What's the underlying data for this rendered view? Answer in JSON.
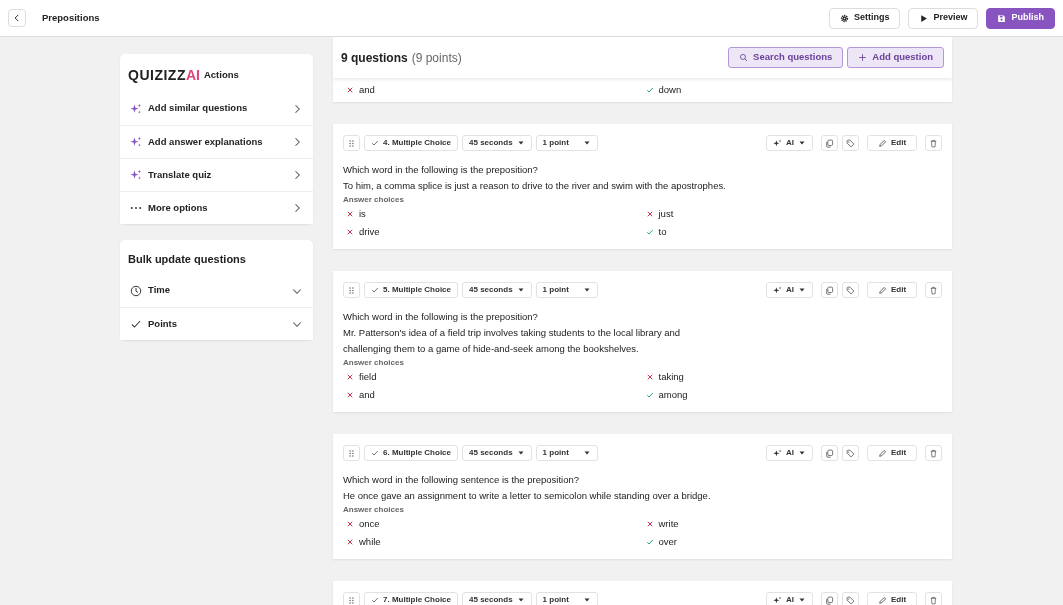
{
  "topbar": {
    "title": "Prepositions",
    "buttons": [
      {
        "label": "Settings",
        "kind": "settings"
      },
      {
        "label": "Preview",
        "kind": "preview"
      },
      {
        "label": "Publish",
        "kind": "publish"
      }
    ]
  },
  "ai_panel": {
    "logo": "QUIZIZZ",
    "logo_ai": "AI",
    "title": "Actions",
    "items": [
      {
        "label": "Add similar questions",
        "kind": "ai"
      },
      {
        "label": "Add answer explanations",
        "kind": "ai"
      },
      {
        "label": "Translate quiz",
        "kind": "ai"
      },
      {
        "label": "More options",
        "kind": "more"
      }
    ]
  },
  "bulk_panel": {
    "title": "Bulk update questions",
    "items": [
      {
        "label": "Time",
        "kind": "time"
      },
      {
        "label": "Points",
        "kind": "points"
      }
    ]
  },
  "questions_header": {
    "count": "9 questions",
    "points": "(9 points)",
    "buttons": [
      {
        "label": "Search questions",
        "kind": "search"
      },
      {
        "label": "Add question",
        "kind": "add"
      }
    ]
  },
  "questions": [
    {
      "answers": [
        {
          "text": "and",
          "correct": false
        },
        {
          "text": "down",
          "correct": true
        }
      ]
    },
    {
      "toolbar": {
        "type": "4. Multiple Choice",
        "time": "45 seconds",
        "points": "1 point",
        "ai": "AI",
        "edit": "Edit"
      },
      "lines": [
        "Which word in the following is the preposition?",
        "To him, a comma splice is just a reason to drive to the river and swim with the apostrophes."
      ],
      "answers_label": "Answer choices",
      "answers": [
        {
          "text": "is",
          "correct": false
        },
        {
          "text": "just",
          "correct": false
        },
        {
          "text": "drive",
          "correct": false
        },
        {
          "text": "to",
          "correct": true
        }
      ]
    },
    {
      "toolbar": {
        "type": "5. Multiple Choice",
        "time": "45 seconds",
        "points": "1 point",
        "ai": "AI",
        "edit": "Edit"
      },
      "lines": [
        "Which word in the following is the preposition?",
        "Mr. Patterson's idea of a field trip involves taking students to the local library and",
        "challenging them to a game of hide-and-seek among the bookshelves."
      ],
      "answers_label": "Answer choices",
      "answers": [
        {
          "text": "field",
          "correct": false
        },
        {
          "text": "taking",
          "correct": false
        },
        {
          "text": "and",
          "correct": false
        },
        {
          "text": "among",
          "correct": true
        }
      ]
    },
    {
      "toolbar": {
        "type": "6. Multiple Choice",
        "time": "45 seconds",
        "points": "1 point",
        "ai": "AI",
        "edit": "Edit"
      },
      "lines": [
        "Which word in the following sentence is the preposition?",
        "He once gave an assignment to write a letter to semicolon while standing over a bridge."
      ],
      "answers_label": "Answer choices",
      "answers": [
        {
          "text": "once",
          "correct": false
        },
        {
          "text": "write",
          "correct": false
        },
        {
          "text": "while",
          "correct": false
        },
        {
          "text": "over",
          "correct": true
        }
      ]
    },
    {
      "toolbar": {
        "type": "7. Multiple Choice",
        "time": "45 seconds",
        "points": "1 point",
        "ai": "AI",
        "edit": "Edit"
      }
    }
  ]
}
